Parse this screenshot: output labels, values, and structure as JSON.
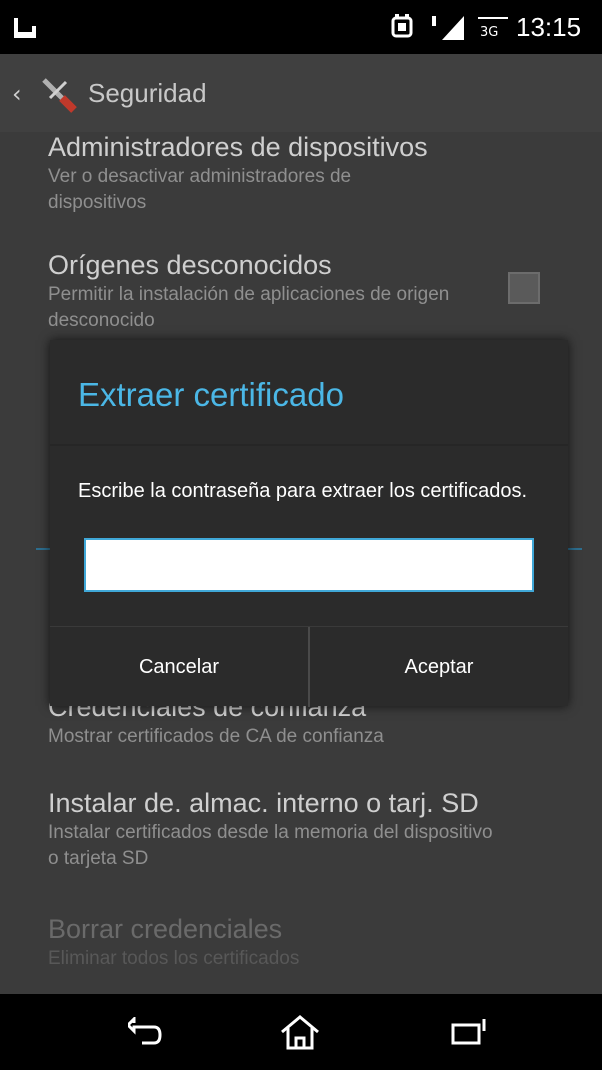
{
  "status_bar": {
    "time": "13:15",
    "icons": [
      "notification-icon",
      "alarm-icon",
      "signal-icon",
      "network-icon"
    ]
  },
  "action_bar": {
    "title": "Seguridad",
    "back_glyph": "‹"
  },
  "settings": {
    "items": [
      {
        "title": "Administradores de dispositivos",
        "subtitle": "Ver o desactivar administradores de dispositivos"
      },
      {
        "title": "Orígenes desconocidos",
        "subtitle": "Permitir la instalación de aplicaciones de origen desconocido",
        "checked": false
      },
      {
        "title": "Credenciales de confianza",
        "subtitle": "Mostrar certificados de CA de confianza"
      },
      {
        "title": "Instalar de. almac. interno o tarj. SD",
        "subtitle": "Instalar certificados desde la memoria del dispositivo o tarjeta SD"
      },
      {
        "title": "Borrar credenciales",
        "subtitle": "Eliminar todos los certificados"
      }
    ]
  },
  "dialog": {
    "title": "Extraer certificado",
    "message": "Escribe la contraseña para extraer los certificados.",
    "password_value": "",
    "cancel_label": "Cancelar",
    "accept_label": "Aceptar"
  },
  "colors": {
    "accent": "#4bb7e6",
    "dialog_bg": "#2b2b2b",
    "screen_dim_bg": "#3b3b3b"
  },
  "nav_bar": {
    "icons": [
      "back-icon",
      "home-icon",
      "recents-icon"
    ]
  }
}
